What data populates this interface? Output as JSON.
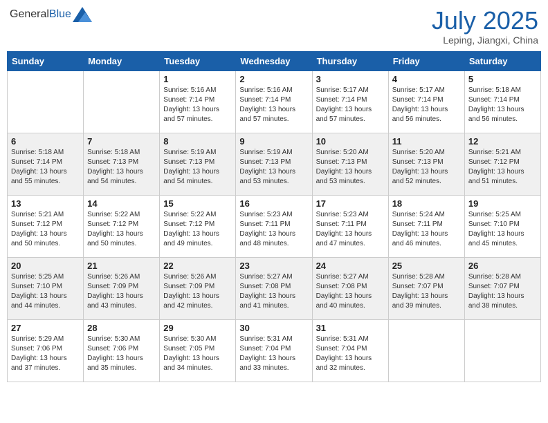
{
  "header": {
    "logo_general": "General",
    "logo_blue": "Blue",
    "month_year": "July 2025",
    "location": "Leping, Jiangxi, China"
  },
  "days_of_week": [
    "Sunday",
    "Monday",
    "Tuesday",
    "Wednesday",
    "Thursday",
    "Friday",
    "Saturday"
  ],
  "weeks": [
    {
      "days": [
        {
          "number": "",
          "info": ""
        },
        {
          "number": "",
          "info": ""
        },
        {
          "number": "1",
          "info": "Sunrise: 5:16 AM\nSunset: 7:14 PM\nDaylight: 13 hours and 57 minutes."
        },
        {
          "number": "2",
          "info": "Sunrise: 5:16 AM\nSunset: 7:14 PM\nDaylight: 13 hours and 57 minutes."
        },
        {
          "number": "3",
          "info": "Sunrise: 5:17 AM\nSunset: 7:14 PM\nDaylight: 13 hours and 57 minutes."
        },
        {
          "number": "4",
          "info": "Sunrise: 5:17 AM\nSunset: 7:14 PM\nDaylight: 13 hours and 56 minutes."
        },
        {
          "number": "5",
          "info": "Sunrise: 5:18 AM\nSunset: 7:14 PM\nDaylight: 13 hours and 56 minutes."
        }
      ]
    },
    {
      "days": [
        {
          "number": "6",
          "info": "Sunrise: 5:18 AM\nSunset: 7:14 PM\nDaylight: 13 hours and 55 minutes."
        },
        {
          "number": "7",
          "info": "Sunrise: 5:18 AM\nSunset: 7:13 PM\nDaylight: 13 hours and 54 minutes."
        },
        {
          "number": "8",
          "info": "Sunrise: 5:19 AM\nSunset: 7:13 PM\nDaylight: 13 hours and 54 minutes."
        },
        {
          "number": "9",
          "info": "Sunrise: 5:19 AM\nSunset: 7:13 PM\nDaylight: 13 hours and 53 minutes."
        },
        {
          "number": "10",
          "info": "Sunrise: 5:20 AM\nSunset: 7:13 PM\nDaylight: 13 hours and 53 minutes."
        },
        {
          "number": "11",
          "info": "Sunrise: 5:20 AM\nSunset: 7:13 PM\nDaylight: 13 hours and 52 minutes."
        },
        {
          "number": "12",
          "info": "Sunrise: 5:21 AM\nSunset: 7:12 PM\nDaylight: 13 hours and 51 minutes."
        }
      ]
    },
    {
      "days": [
        {
          "number": "13",
          "info": "Sunrise: 5:21 AM\nSunset: 7:12 PM\nDaylight: 13 hours and 50 minutes."
        },
        {
          "number": "14",
          "info": "Sunrise: 5:22 AM\nSunset: 7:12 PM\nDaylight: 13 hours and 50 minutes."
        },
        {
          "number": "15",
          "info": "Sunrise: 5:22 AM\nSunset: 7:12 PM\nDaylight: 13 hours and 49 minutes."
        },
        {
          "number": "16",
          "info": "Sunrise: 5:23 AM\nSunset: 7:11 PM\nDaylight: 13 hours and 48 minutes."
        },
        {
          "number": "17",
          "info": "Sunrise: 5:23 AM\nSunset: 7:11 PM\nDaylight: 13 hours and 47 minutes."
        },
        {
          "number": "18",
          "info": "Sunrise: 5:24 AM\nSunset: 7:11 PM\nDaylight: 13 hours and 46 minutes."
        },
        {
          "number": "19",
          "info": "Sunrise: 5:25 AM\nSunset: 7:10 PM\nDaylight: 13 hours and 45 minutes."
        }
      ]
    },
    {
      "days": [
        {
          "number": "20",
          "info": "Sunrise: 5:25 AM\nSunset: 7:10 PM\nDaylight: 13 hours and 44 minutes."
        },
        {
          "number": "21",
          "info": "Sunrise: 5:26 AM\nSunset: 7:09 PM\nDaylight: 13 hours and 43 minutes."
        },
        {
          "number": "22",
          "info": "Sunrise: 5:26 AM\nSunset: 7:09 PM\nDaylight: 13 hours and 42 minutes."
        },
        {
          "number": "23",
          "info": "Sunrise: 5:27 AM\nSunset: 7:08 PM\nDaylight: 13 hours and 41 minutes."
        },
        {
          "number": "24",
          "info": "Sunrise: 5:27 AM\nSunset: 7:08 PM\nDaylight: 13 hours and 40 minutes."
        },
        {
          "number": "25",
          "info": "Sunrise: 5:28 AM\nSunset: 7:07 PM\nDaylight: 13 hours and 39 minutes."
        },
        {
          "number": "26",
          "info": "Sunrise: 5:28 AM\nSunset: 7:07 PM\nDaylight: 13 hours and 38 minutes."
        }
      ]
    },
    {
      "days": [
        {
          "number": "27",
          "info": "Sunrise: 5:29 AM\nSunset: 7:06 PM\nDaylight: 13 hours and 37 minutes."
        },
        {
          "number": "28",
          "info": "Sunrise: 5:30 AM\nSunset: 7:06 PM\nDaylight: 13 hours and 35 minutes."
        },
        {
          "number": "29",
          "info": "Sunrise: 5:30 AM\nSunset: 7:05 PM\nDaylight: 13 hours and 34 minutes."
        },
        {
          "number": "30",
          "info": "Sunrise: 5:31 AM\nSunset: 7:04 PM\nDaylight: 13 hours and 33 minutes."
        },
        {
          "number": "31",
          "info": "Sunrise: 5:31 AM\nSunset: 7:04 PM\nDaylight: 13 hours and 32 minutes."
        },
        {
          "number": "",
          "info": ""
        },
        {
          "number": "",
          "info": ""
        }
      ]
    }
  ]
}
